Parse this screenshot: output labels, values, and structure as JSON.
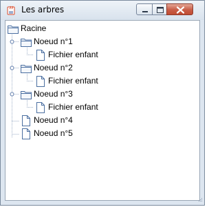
{
  "window": {
    "title": "Les arbres",
    "app_icon": "java-cup-icon"
  },
  "controls": {
    "minimize_icon": "minimize-icon",
    "maximize_icon": "maximize-icon",
    "close_icon": "close-icon"
  },
  "tree": {
    "root": {
      "label": "Racine",
      "icon": "folder-icon"
    },
    "nodes": [
      {
        "label": "Noeud n°1",
        "icon": "folder-icon",
        "expanded": true,
        "children": [
          {
            "label": "Fichier enfant",
            "icon": "file-icon"
          }
        ]
      },
      {
        "label": "Noeud n°2",
        "icon": "folder-icon",
        "expanded": true,
        "children": [
          {
            "label": "Fichier enfant",
            "icon": "file-icon"
          }
        ]
      },
      {
        "label": "Noeud n°3",
        "icon": "folder-icon",
        "expanded": true,
        "children": [
          {
            "label": "Fichier enfant",
            "icon": "file-icon"
          }
        ]
      },
      {
        "label": "Noeud n°4",
        "icon": "file-icon"
      },
      {
        "label": "Noeud n°5",
        "icon": "file-icon"
      }
    ]
  },
  "colors": {
    "folder_stroke": "#4a6ea0",
    "file_stroke": "#4a6ea0",
    "tree_line": "#a0b0c8"
  }
}
